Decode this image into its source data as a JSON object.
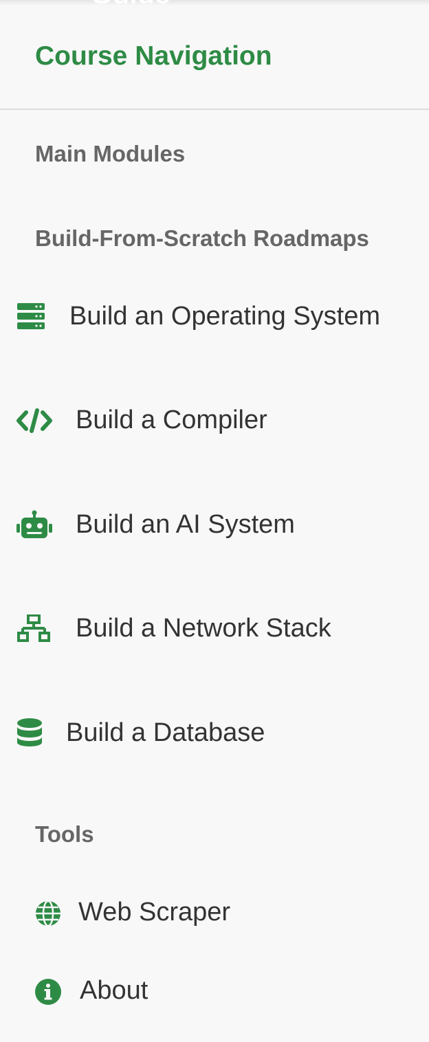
{
  "header_behind": {
    "title_fragment": "Guide"
  },
  "drawer": {
    "title": "Course Navigation",
    "accent_color": "#2e8b45",
    "sections": {
      "main_modules": "Main Modules",
      "roadmaps": "Build-From-Scratch Roadmaps",
      "tools": "Tools"
    },
    "roadmap_items": [
      {
        "label": "Build an Operating System",
        "icon": "server-icon"
      },
      {
        "label": "Build a Compiler",
        "icon": "code-icon"
      },
      {
        "label": "Build an AI System",
        "icon": "robot-icon"
      },
      {
        "label": "Build a Network Stack",
        "icon": "network-icon"
      },
      {
        "label": "Build a Database",
        "icon": "database-icon"
      }
    ],
    "tool_items": [
      {
        "label": "Web Scraper",
        "icon": "globe-icon"
      },
      {
        "label": "About",
        "icon": "info-icon"
      }
    ]
  }
}
